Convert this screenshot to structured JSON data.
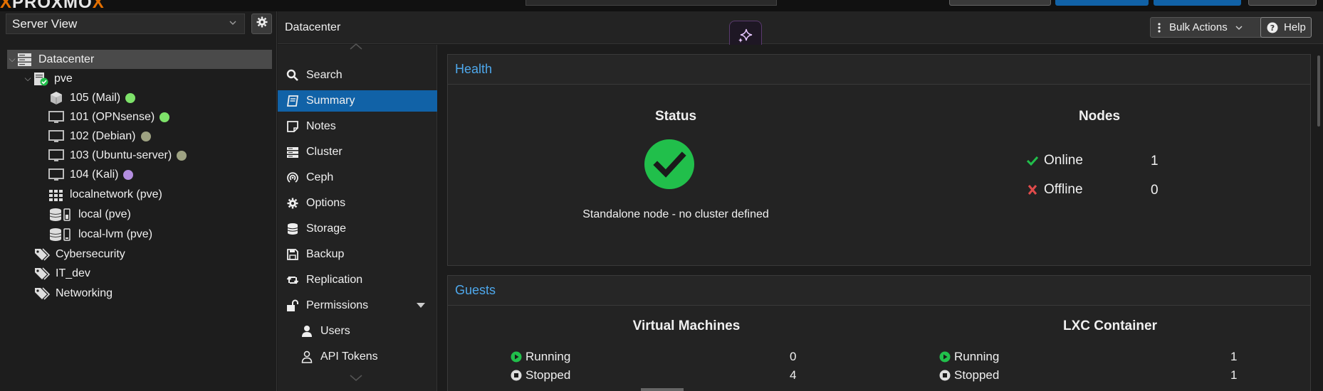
{
  "topbar": {
    "logo_x": "X",
    "logo_rest": "PROXMO",
    "logo_x2": "X"
  },
  "sidebar": {
    "view_label": "Server View",
    "tree": [
      {
        "label": "Datacenter"
      },
      {
        "label": "pve"
      },
      {
        "label": "105 (Mail)",
        "status_color": "#7ee26a"
      },
      {
        "label": "101 (OPNsense)",
        "status_color": "#7ee26a"
      },
      {
        "label": "102 (Debian)",
        "status_color": "#9ea282"
      },
      {
        "label": "103 (Ubuntu-server)",
        "status_color": "#9ea282"
      },
      {
        "label": "104 (Kali)",
        "status_color": "#b48ee0"
      },
      {
        "label": "localnetwork (pve)"
      },
      {
        "label": "local (pve)"
      },
      {
        "label": "local-lvm (pve)"
      },
      {
        "label": "Cybersecurity"
      },
      {
        "label": "IT_dev"
      },
      {
        "label": "Networking"
      }
    ]
  },
  "header": {
    "breadcrumb": "Datacenter",
    "bulk_actions_label": "Bulk Actions",
    "help_label": "Help"
  },
  "nav": {
    "items": [
      {
        "label": "Search",
        "icon": "search-icon"
      },
      {
        "label": "Summary",
        "icon": "book-icon"
      },
      {
        "label": "Notes",
        "icon": "note-icon"
      },
      {
        "label": "Cluster",
        "icon": "server-icon"
      },
      {
        "label": "Ceph",
        "icon": "ceph-icon"
      },
      {
        "label": "Options",
        "icon": "gear-icon"
      },
      {
        "label": "Storage",
        "icon": "database-icon"
      },
      {
        "label": "Backup",
        "icon": "floppy-icon"
      },
      {
        "label": "Replication",
        "icon": "retweet-icon"
      },
      {
        "label": "Permissions",
        "icon": "unlock-icon"
      },
      {
        "label": "Users",
        "icon": "user-icon"
      },
      {
        "label": "API Tokens",
        "icon": "user-outline-icon"
      }
    ]
  },
  "health": {
    "title": "Health",
    "status_heading": "Status",
    "status_text": "Standalone node - no cluster defined",
    "nodes_heading": "Nodes",
    "online_label": "Online",
    "online_count": "1",
    "offline_label": "Offline",
    "offline_count": "0"
  },
  "guests": {
    "title": "Guests",
    "vm_heading": "Virtual Machines",
    "lxc_heading": "LXC Container",
    "vm": {
      "running_label": "Running",
      "running": "0",
      "stopped_label": "Stopped",
      "stopped": "4"
    },
    "lxc": {
      "running_label": "Running",
      "running": "1",
      "stopped_label": "Stopped",
      "stopped": "1"
    }
  },
  "colors": {
    "accent": "#1162a7",
    "link": "#4ea8ec",
    "ok": "#21bf4b",
    "err": "#e04b4b"
  }
}
